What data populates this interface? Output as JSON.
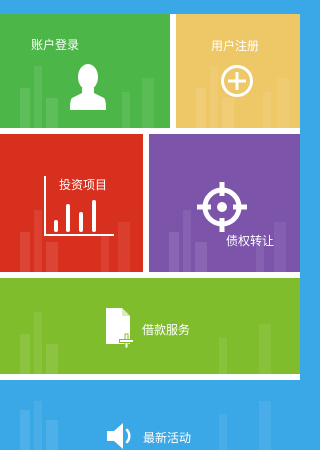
{
  "tiles": {
    "login": {
      "label": "账户登录",
      "icon": "user-silhouette-icon",
      "color": "#4cb748"
    },
    "register": {
      "label": "用户注册",
      "icon": "plus-circle-icon",
      "color": "#eec767"
    },
    "invest": {
      "label": "投资项目",
      "icon": "bar-chart-icon",
      "color": "#d8301f"
    },
    "transfer": {
      "label": "债权转让",
      "icon": "crosshair-icon",
      "color": "#7c54aa"
    },
    "loan": {
      "label": "借款服务",
      "icon": "document-add-icon",
      "color": "#7fbd2c"
    },
    "news": {
      "label": "最新活动",
      "icon": "speaker-icon",
      "color": "#3aa7e6"
    }
  }
}
